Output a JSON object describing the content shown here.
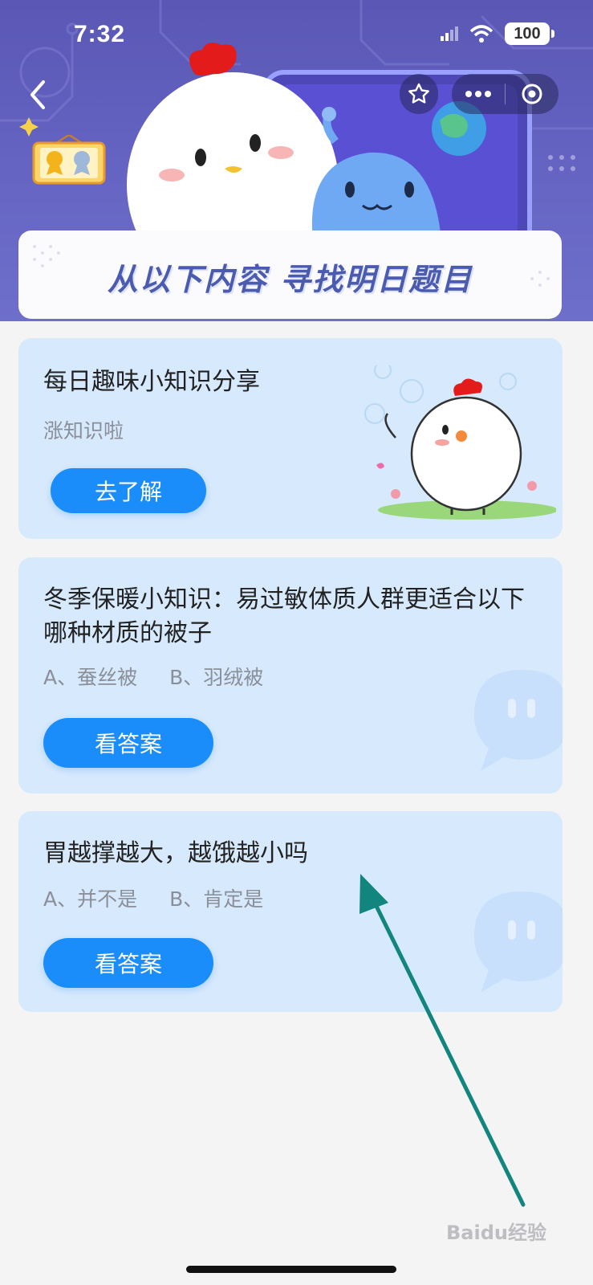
{
  "status_bar": {
    "time": "7:32",
    "battery": "100"
  },
  "header": {
    "banner_title": "从以下内容 寻找明日题目"
  },
  "cards": [
    {
      "title": "每日趣味小知识分享",
      "subtitle": "涨知识啦",
      "button": "去了解"
    },
    {
      "title": "冬季保暖小知识：易过敏体质人群更适合以下哪种材质的被子",
      "option_a": "A、蚕丝被",
      "option_b": "B、羽绒被",
      "button": "看答案"
    },
    {
      "title": "胃越撑越大，越饿越小吗",
      "option_a": "A、并不是",
      "option_b": "B、肯定是",
      "button": "看答案"
    }
  ],
  "watermark": "Baidu经验",
  "colors": {
    "header": "#5a57b5",
    "card_bg": "#d7e9fc",
    "button": "#1a8dfb",
    "arrow": "#13857f"
  }
}
